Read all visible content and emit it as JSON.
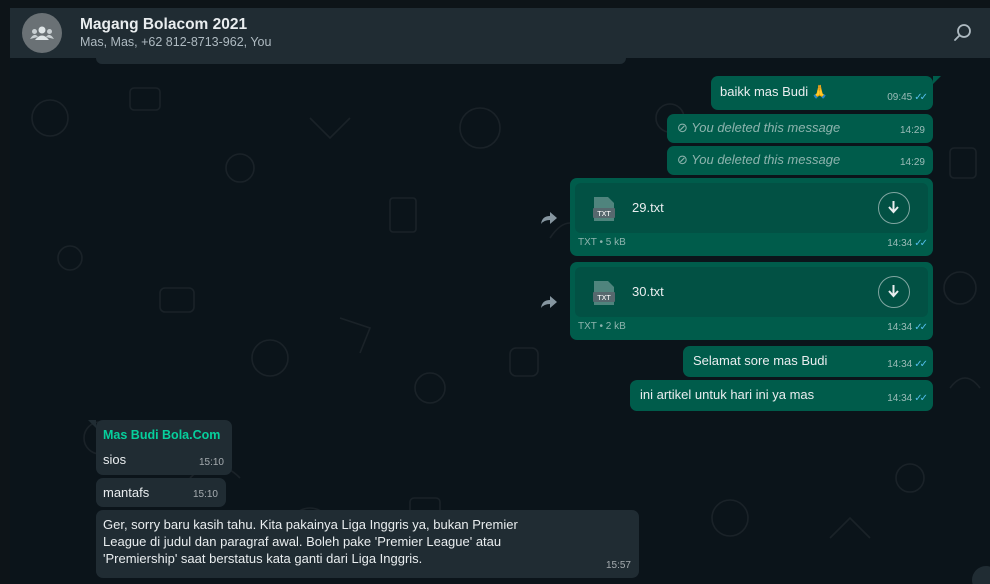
{
  "header": {
    "title": "Magang Bolacom 2021",
    "participants": "Mas, Mas, +62 812-8713-962, You"
  },
  "messages": {
    "m1": {
      "text": "baikk mas Budi 🙏",
      "time": "09:45",
      "ticks": "✓✓"
    },
    "m2": {
      "text": "You deleted this message",
      "time": "14:29"
    },
    "m3": {
      "text": "You deleted this message",
      "time": "14:29"
    },
    "f1": {
      "name": "29.txt",
      "icon_label": "TXT",
      "meta": "TXT • 5 kB",
      "time": "14:34",
      "ticks": "✓✓"
    },
    "f2": {
      "name": "30.txt",
      "icon_label": "TXT",
      "meta": "TXT • 2 kB",
      "time": "14:34",
      "ticks": "✓✓"
    },
    "m4": {
      "text": "Selamat sore mas Budi",
      "time": "14:34",
      "ticks": "✓✓"
    },
    "m5": {
      "text": "ini artikel untuk hari ini ya mas",
      "time": "14:34",
      "ticks": "✓✓"
    },
    "r1": {
      "sender": "Mas Budi Bola.Com",
      "text": "sios",
      "time": "15:10"
    },
    "r2": {
      "text": "mantafs",
      "time": "15:10"
    },
    "r3": {
      "line1": "Ger, sorry baru kasih tahu. Kita pakainya Liga Inggris ya, bukan Premier",
      "line2": "League di judul dan paragraf awal. Boleh pake 'Premier League' atau",
      "line3": "'Premiership' saat berstatus kata ganti dari Liga Inggris.",
      "time": "15:57"
    }
  },
  "colors": {
    "outgoing_bubble": "#005c4b",
    "incoming_bubble": "#202c33",
    "sender_name": "#06cf9c",
    "read_ticks": "#53bdeb"
  }
}
